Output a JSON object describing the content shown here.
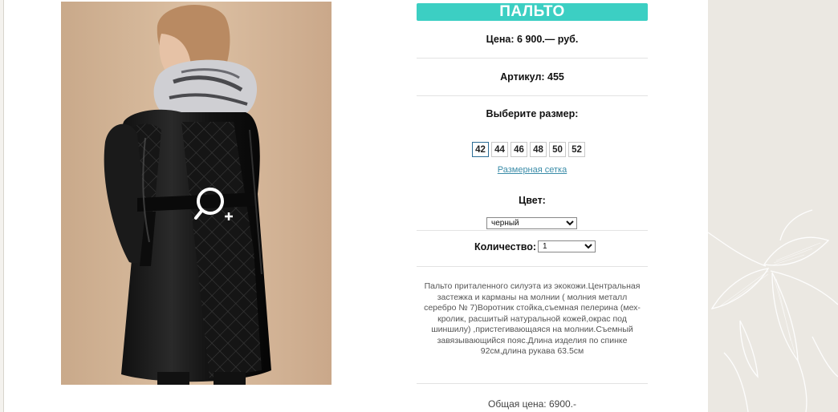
{
  "product": {
    "title": "ПАЛЬТО",
    "price": "Цена: 6 900.— руб.",
    "sku": "Артикул: 455",
    "choose_size_label": "Выберите размер:",
    "sizes": [
      "42",
      "44",
      "46",
      "48",
      "50",
      "52"
    ],
    "selected_size": "42",
    "size_chart_link": "Размерная сетка",
    "color_label": "Цвет:",
    "color_value": "черный",
    "quantity_label": "Количество:",
    "quantity_value": "1",
    "description": "Пальто приталенного силуэта из экокожи.Центральная застежка и карманы на молнии ( молния металл серебро № 7)Воротник стойка,съемная пелерина (мех-кролик, расшитый натуральной кожей,окрас под шиншилу) ,пристегивающаяся на молнии.Съемный завязывающийся пояс.Длина изделия по спинке 92см,длина рукава 63.5см",
    "total": "Общая цена: 6900.-"
  },
  "icons": {
    "zoom": "zoom-in-icon"
  },
  "colors": {
    "title_bar": "#3ccfc3",
    "link": "#3a8ca8",
    "selected_size_border": "#2c6d96",
    "side_background": "#ebe8e2"
  }
}
